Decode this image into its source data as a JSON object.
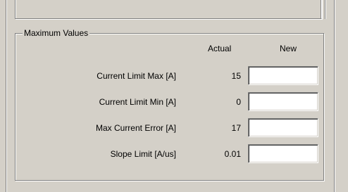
{
  "group": {
    "title": "Maximum Values",
    "headers": {
      "actual": "Actual",
      "new": "New"
    },
    "rows": [
      {
        "label": "Current Limit Max [A]",
        "actual": "15",
        "new_value": ""
      },
      {
        "label": "Current Limit Min [A]",
        "actual": "0",
        "new_value": ""
      },
      {
        "label": "Max Current Error [A]",
        "actual": "17",
        "new_value": ""
      },
      {
        "label": "Slope Limit [A/us]",
        "actual": "0.01",
        "new_value": ""
      }
    ]
  },
  "colors": {
    "background": "#d4d0c8",
    "shadow": "#808080",
    "highlight": "#ffffff",
    "input_background": "#ffffff"
  }
}
